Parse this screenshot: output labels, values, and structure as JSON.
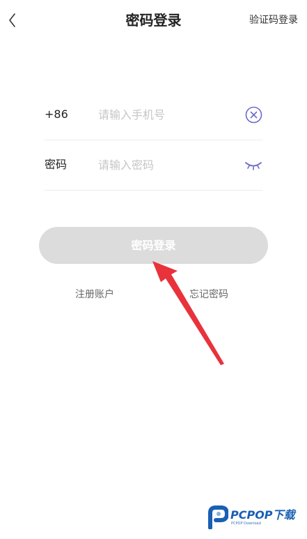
{
  "header": {
    "back_icon": "chevron-left-icon",
    "title": "密码登录",
    "switch_label": "验证码登录"
  },
  "form": {
    "phone": {
      "prefix": "+86",
      "placeholder": "请输入手机号",
      "value": "",
      "clear_icon": "clear-circle-icon"
    },
    "password": {
      "label": "密码",
      "placeholder": "请输入密码",
      "value": "",
      "toggle_icon": "eye-closed-icon"
    },
    "submit_label": "密码登录"
  },
  "links": {
    "register": "注册账户",
    "forgot": "忘记密码"
  },
  "watermark": {
    "brand": "PCPOP下载",
    "sub": "PCPOP Download"
  },
  "colors": {
    "accent_icon": "#6b6bc8",
    "button_disabled": "#dcdcdc",
    "annotation_arrow": "#e8323c",
    "watermark": "#1a5fb4"
  }
}
